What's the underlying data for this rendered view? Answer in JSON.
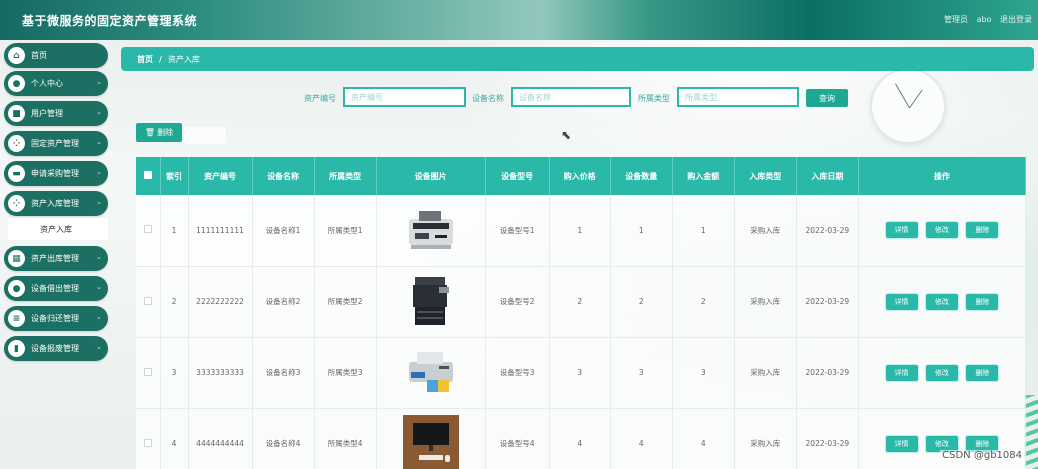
{
  "app": {
    "title": "基于微服务的固定资产管理系统",
    "user_role": "管理员",
    "user_name": "abo",
    "logout": "退出登录"
  },
  "sidebar": {
    "items": [
      {
        "label": "首页",
        "icon": "home-icon",
        "expandable": false
      },
      {
        "label": "个人中心",
        "icon": "user-icon",
        "expandable": true
      },
      {
        "label": "用户管理",
        "icon": "users-icon",
        "expandable": true
      },
      {
        "label": "固定资产管理",
        "icon": "grid-icon",
        "expandable": true
      },
      {
        "label": "申请采购管理",
        "icon": "cart-icon",
        "expandable": true
      },
      {
        "label": "资产入库管理",
        "icon": "grid-icon",
        "expandable": true
      },
      {
        "label": "资产出库管理",
        "icon": "box-icon",
        "expandable": true
      },
      {
        "label": "设备借出管理",
        "icon": "user-icon",
        "expandable": true
      },
      {
        "label": "设备归还管理",
        "icon": "list-icon",
        "expandable": true
      },
      {
        "label": "设备报废管理",
        "icon": "bar-chart-icon",
        "expandable": true
      }
    ],
    "active_sub": "资产入库"
  },
  "breadcrumb": {
    "home": "首页",
    "separator": "/",
    "current": "资产入库"
  },
  "search": {
    "fields": [
      {
        "label": "资产编号",
        "placeholder": "资产编号"
      },
      {
        "label": "设备名称",
        "placeholder": "设备名称"
      },
      {
        "label": "所属类型",
        "placeholder": "所属类型"
      }
    ],
    "query_button": "查询"
  },
  "toolbar": {
    "delete_button": "删除"
  },
  "table": {
    "headers": [
      "",
      "索引",
      "资产编号",
      "设备名称",
      "所属类型",
      "设备图片",
      "设备型号",
      "购入价格",
      "设备数量",
      "购入金额",
      "入库类型",
      "入库日期",
      "操作"
    ],
    "actions": {
      "detail": "详情",
      "edit": "修改",
      "delete": "删除"
    },
    "rows": [
      {
        "index": "1",
        "asset_no": "1111111111",
        "name": "设备名称1",
        "type": "所属类型1",
        "image": "currency-counter",
        "model": "设备型号1",
        "price": "1",
        "qty": "1",
        "amount": "1",
        "in_type": "采购入库",
        "date": "2022-03-29"
      },
      {
        "index": "2",
        "asset_no": "2222222222",
        "name": "设备名称2",
        "type": "所属类型2",
        "image": "office-copier",
        "model": "设备型号2",
        "price": "2",
        "qty": "2",
        "amount": "2",
        "in_type": "采购入库",
        "date": "2022-03-29"
      },
      {
        "index": "3",
        "asset_no": "3333333333",
        "name": "设备名称3",
        "type": "所属类型3",
        "image": "inkjet-printer",
        "model": "设备型号3",
        "price": "3",
        "qty": "3",
        "amount": "3",
        "in_type": "采购入库",
        "date": "2022-03-29"
      },
      {
        "index": "4",
        "asset_no": "4444444444",
        "name": "设备名称4",
        "type": "所属类型4",
        "image": "desk-monitor",
        "model": "设备型号4",
        "price": "4",
        "qty": "4",
        "amount": "4",
        "in_type": "采购入库",
        "date": "2022-03-29"
      }
    ]
  },
  "watermark": "CSDN @gb1084",
  "colors": {
    "accent": "#2ab8a8",
    "sidebar": "#1b6f63",
    "button": "#1fa894"
  }
}
